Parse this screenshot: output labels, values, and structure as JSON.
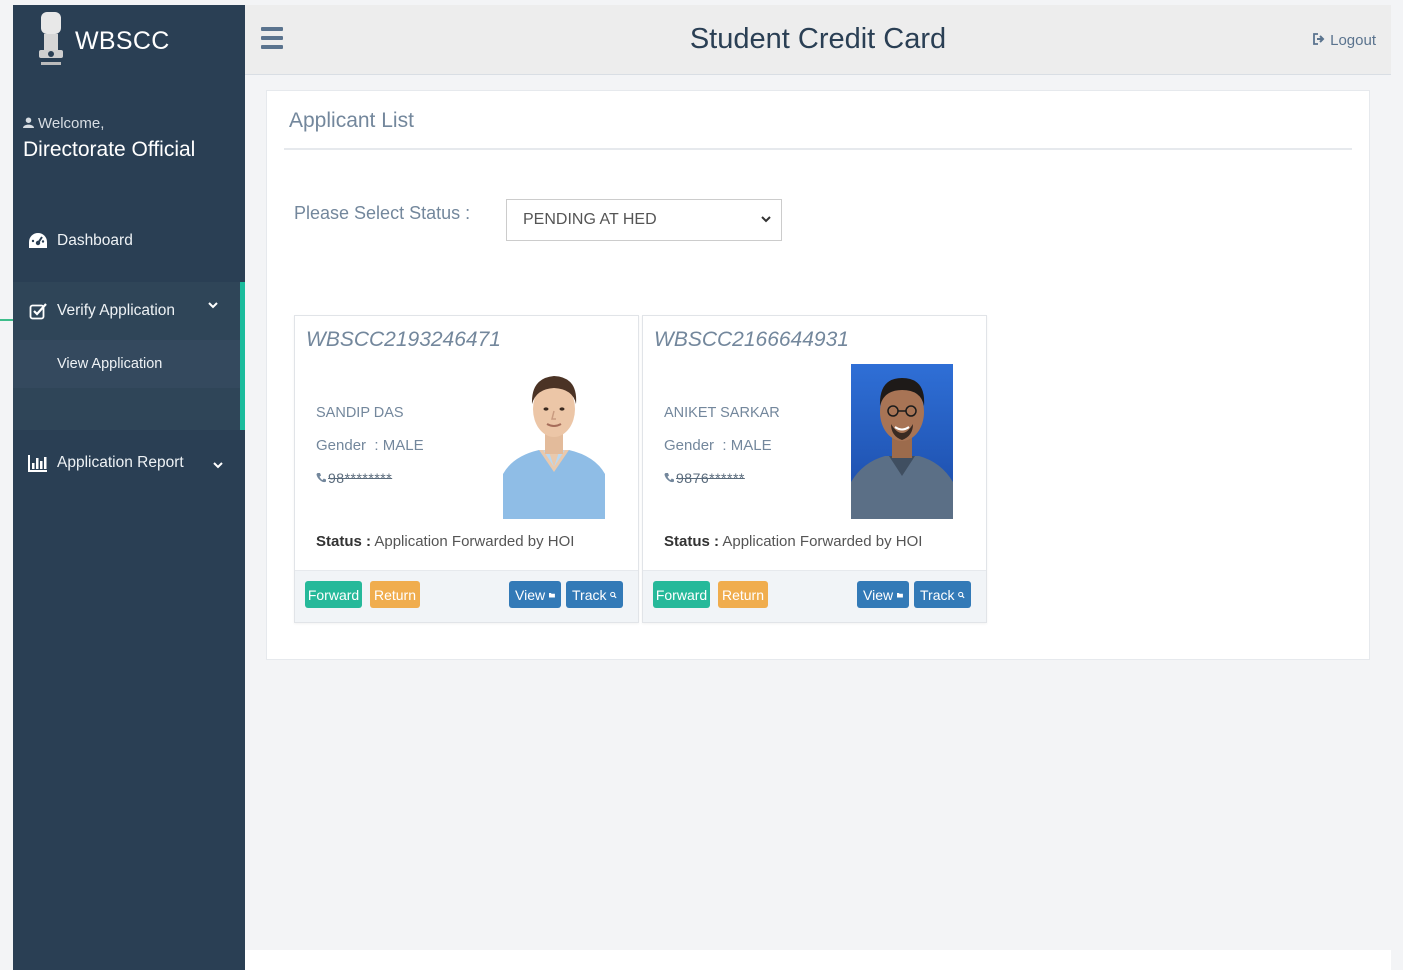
{
  "brand": {
    "name": "WBSCC"
  },
  "sidebar": {
    "welcome": "Welcome,",
    "user_name": "Directorate Official",
    "items": [
      {
        "label": "Dashboard",
        "icon": "dashboard-icon"
      },
      {
        "label": "Verify Application",
        "icon": "check-square-icon",
        "expanded": true,
        "children": [
          {
            "label": "View Application"
          }
        ]
      },
      {
        "label": "Application Report",
        "icon": "bar-chart-icon"
      }
    ]
  },
  "header": {
    "title": "Student Credit Card",
    "logout": "Logout"
  },
  "main": {
    "panel_title": "Applicant List",
    "status_label": "Please Select Status :",
    "status_value": "PENDING AT HED"
  },
  "cards": [
    {
      "id": "WBSCC2193246471",
      "name": "SANDIP DAS",
      "gender_label": "Gender",
      "gender_value": ": MALE",
      "phone": "98********",
      "status_label": "Status :",
      "status_value": "Application Forwarded by HOI",
      "buttons": {
        "forward": "Forward",
        "return": "Return",
        "view": "View",
        "track": "Track"
      }
    },
    {
      "id": "WBSCC2166644931",
      "name": "ANIKET SARKAR",
      "gender_label": "Gender",
      "gender_value": ": MALE",
      "phone": "9876******",
      "status_label": "Status :",
      "status_value": "Application Forwarded by HOI",
      "buttons": {
        "forward": "Forward",
        "return": "Return",
        "view": "View",
        "track": "Track"
      }
    }
  ],
  "colors": {
    "sidebar": "#2a3f54",
    "accent_green": "#26b99a",
    "warning": "#f0ad4e",
    "primary": "#337ab7"
  }
}
